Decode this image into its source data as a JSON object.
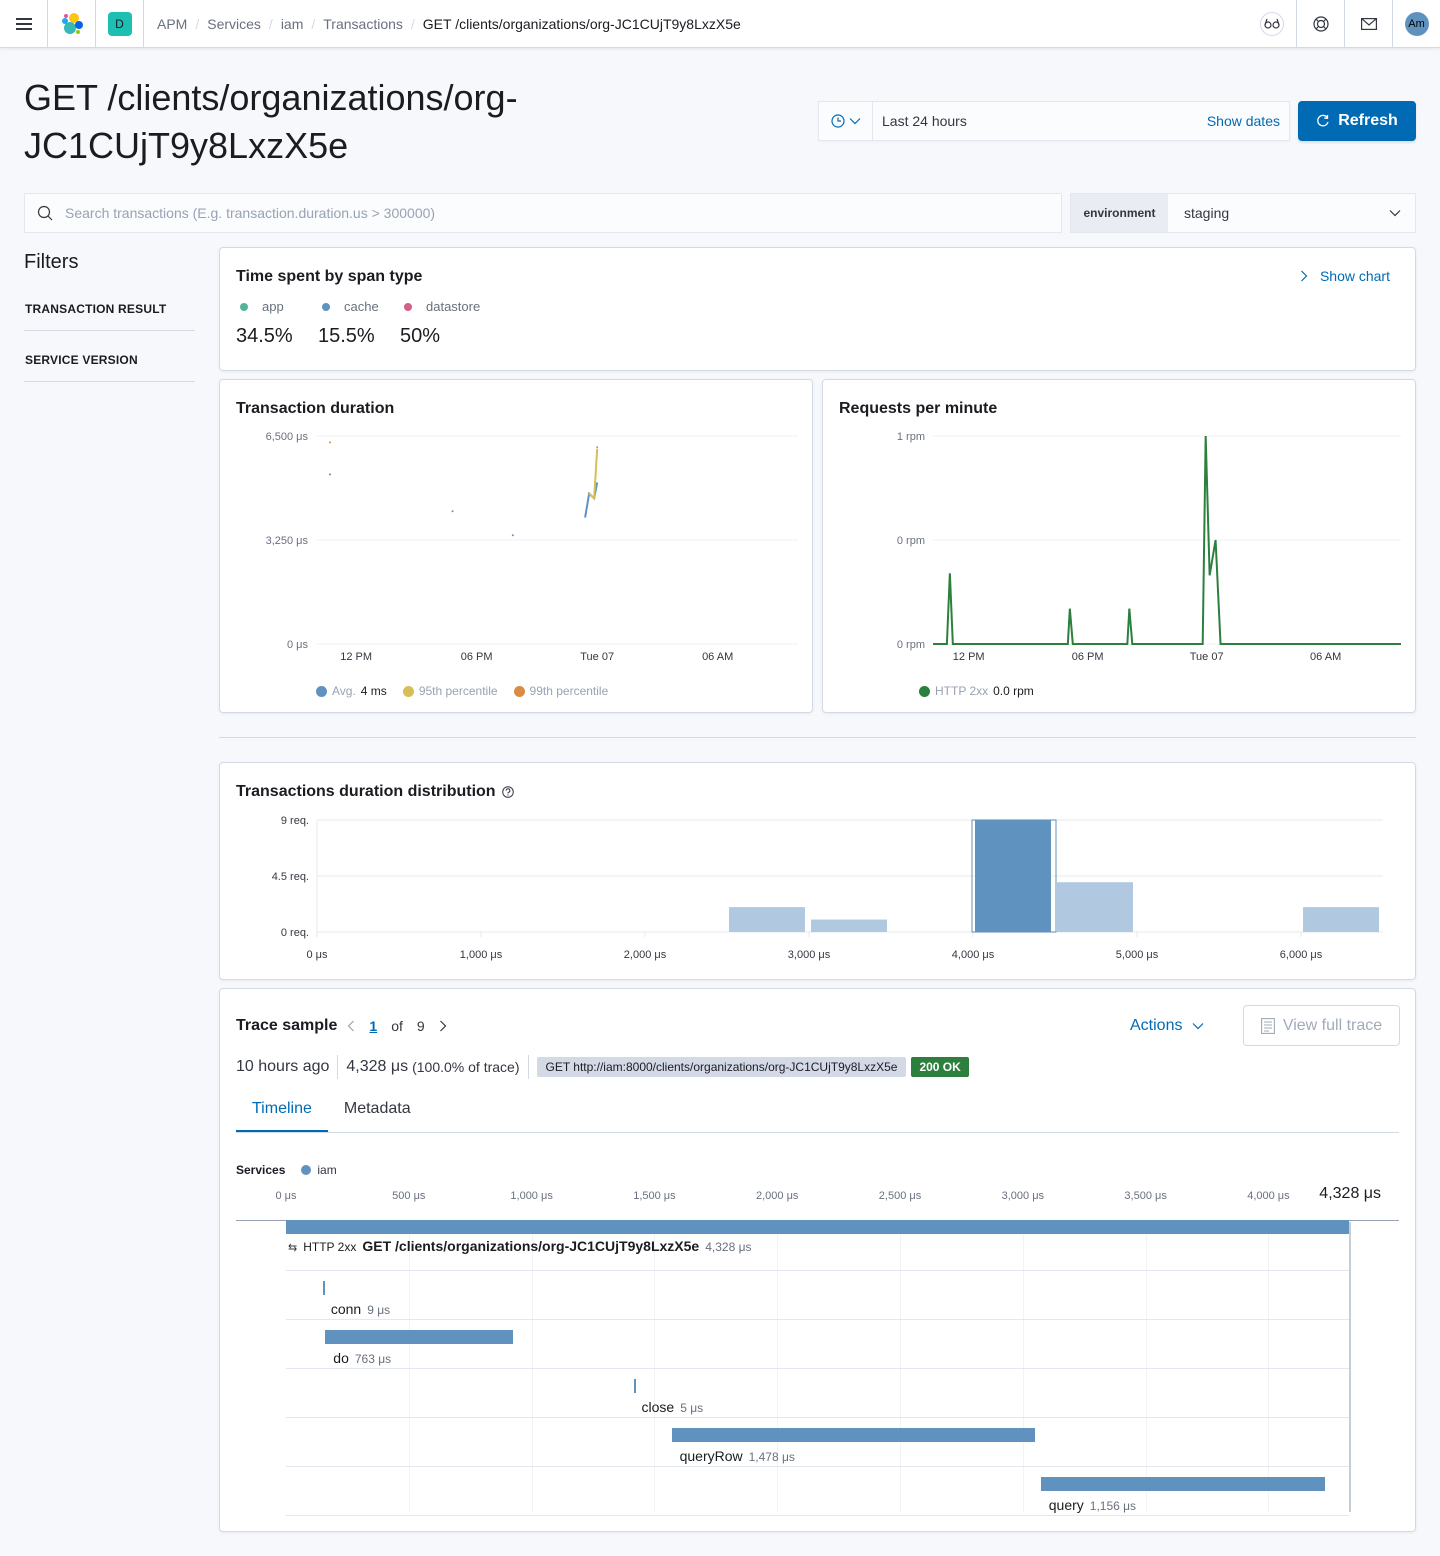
{
  "header": {
    "space_initial": "D",
    "breadcrumbs": [
      "APM",
      "Services",
      "iam",
      "Transactions",
      "GET /clients/organizations/org-JC1CUjT9y8LxzX5e"
    ],
    "avatar_initials": "Am"
  },
  "page": {
    "title": "GET /clients/organizations/org-JC1CUjT9y8LxzX5e"
  },
  "datepicker": {
    "value": "Last 24 hours",
    "show_dates_label": "Show dates",
    "refresh_label": "Refresh"
  },
  "search": {
    "placeholder": "Search transactions (E.g. transaction.duration.us > 300000)"
  },
  "environment": {
    "label": "environment",
    "value": "staging"
  },
  "filters": {
    "title": "Filters",
    "items": [
      "TRANSACTION RESULT",
      "SERVICE VERSION"
    ]
  },
  "span_types": {
    "title": "Time spent by span type",
    "show_chart_label": "Show chart",
    "items": [
      {
        "label": "app",
        "value": "34.5%",
        "color": "#54b399"
      },
      {
        "label": "cache",
        "value": "15.5%",
        "color": "#6092c0"
      },
      {
        "label": "datastore",
        "value": "50%",
        "color": "#d36086"
      }
    ]
  },
  "transaction_duration": {
    "title": "Transaction duration",
    "legend": [
      {
        "label": "Avg.",
        "value": "4 ms",
        "color": "#6092c0"
      },
      {
        "label": "95th percentile",
        "value": "",
        "color": "#d6bf57"
      },
      {
        "label": "99th percentile",
        "value": "",
        "color": "#da8b45"
      }
    ]
  },
  "requests_per_minute": {
    "title": "Requests per minute",
    "legend": [
      {
        "label": "HTTP 2xx",
        "value": "0.0 rpm",
        "color": "#2d7f3e"
      }
    ]
  },
  "distribution": {
    "title": "Transactions duration distribution"
  },
  "chart_data": [
    {
      "type": "line",
      "title": "Transaction duration",
      "x_ticks": [
        "12 PM",
        "06 PM",
        "Tue 07",
        "06 AM"
      ],
      "y_ticks": [
        "0 μs",
        "3,250 μs",
        "6,500 μs"
      ],
      "ylim": [
        0,
        6500
      ],
      "x_hours_range": [
        10,
        34
      ],
      "x_tick_hours": [
        12,
        18,
        24,
        30
      ],
      "series": [
        {
          "name": "Avg.",
          "color": "#6092c0",
          "points": [
            [
              10.7,
              5300
            ],
            [
              16.8,
              4150
            ],
            [
              19.8,
              3400
            ],
            [
              23.4,
              3950
            ],
            [
              23.6,
              4700
            ],
            [
              23.85,
              4550
            ],
            [
              24.0,
              5050
            ]
          ]
        },
        {
          "name": "95th percentile",
          "color": "#d6bf57",
          "points": [
            [
              23.6,
              4700
            ],
            [
              23.85,
              4550
            ],
            [
              24.0,
              6100
            ]
          ]
        },
        {
          "name": "99th percentile",
          "color": "#da8b45",
          "points": [
            [
              10.7,
              6300
            ],
            [
              24.0,
              6150
            ]
          ]
        }
      ]
    },
    {
      "type": "line",
      "title": "Requests per minute",
      "x_ticks": [
        "12 PM",
        "06 PM",
        "Tue 07",
        "06 AM"
      ],
      "y_ticks": [
        "0 rpm",
        "0 rpm",
        "1 rpm"
      ],
      "ylim": [
        0,
        1
      ],
      "x_hours_range": [
        10.2,
        33.8
      ],
      "x_tick_hours": [
        12,
        18,
        24,
        30
      ],
      "series": [
        {
          "name": "HTTP 2xx",
          "color": "#2d7f3e",
          "points": [
            [
              10.2,
              0
            ],
            [
              10.9,
              0
            ],
            [
              11.05,
              0.34
            ],
            [
              11.2,
              0
            ],
            [
              17.0,
              0
            ],
            [
              17.1,
              0.17
            ],
            [
              17.25,
              0
            ],
            [
              20.0,
              0
            ],
            [
              20.1,
              0.17
            ],
            [
              20.25,
              0
            ],
            [
              23.8,
              0
            ],
            [
              23.95,
              1.0
            ],
            [
              24.15,
              0.33
            ],
            [
              24.45,
              0.5
            ],
            [
              24.7,
              0
            ],
            [
              33.8,
              0
            ]
          ]
        }
      ]
    },
    {
      "type": "bar",
      "title": "Transactions duration distribution",
      "xlabel": "",
      "ylabel": "",
      "x_ticks": [
        "0 μs",
        "1,000 μs",
        "2,000 μs",
        "3,000 μs",
        "4,000 μs",
        "5,000 μs",
        "6,000 μs"
      ],
      "y_ticks": [
        "0 req.",
        "4.5 req.",
        "9 req."
      ],
      "xlim": [
        0,
        6500
      ],
      "ylim": [
        0,
        9
      ],
      "bins": [
        {
          "start": 2500,
          "end": 3000,
          "count": 2,
          "selected": false
        },
        {
          "start": 3000,
          "end": 3500,
          "count": 1,
          "selected": false
        },
        {
          "start": 4000,
          "end": 4500,
          "count": 9,
          "selected": true
        },
        {
          "start": 4500,
          "end": 5000,
          "count": 4,
          "selected": false
        },
        {
          "start": 6000,
          "end": 6500,
          "count": 2,
          "selected": false
        }
      ]
    }
  ],
  "trace": {
    "title": "Trace sample",
    "page_current": "1",
    "page_of": "of",
    "page_total": "9",
    "actions_label": "Actions",
    "view_full_trace_label": "View full trace",
    "age": "10 hours ago",
    "duration": "4,328 μs",
    "duration_pct": "(100.0% of trace)",
    "url": "GET http://iam:8000/clients/organizations/org-JC1CUjT9y8LxzX5e",
    "status": "200 OK",
    "tabs": [
      "Timeline",
      "Metadata"
    ],
    "services_label": "Services",
    "service_name": "iam",
    "total_label": "4,328 μs",
    "total_us": 4328,
    "axis_ticks": [
      "0 μs",
      "500 μs",
      "1,000 μs",
      "1,500 μs",
      "2,000 μs",
      "2,500 μs",
      "3,000 μs",
      "3,500 μs",
      "4,000 μs"
    ],
    "axis_tick_values": [
      0,
      500,
      1000,
      1500,
      2000,
      2500,
      3000,
      3500,
      4000
    ],
    "root": {
      "result": "HTTP 2xx",
      "name": "GET /clients/organizations/org-JC1CUjT9y8LxzX5e",
      "duration": "4,328 μs",
      "start_us": 0,
      "dur_us": 4328
    },
    "spans": [
      {
        "name": "conn",
        "duration": "9 μs",
        "start_us": 150,
        "dur_us": 9
      },
      {
        "name": "do",
        "duration": "763 μs",
        "start_us": 160,
        "dur_us": 763
      },
      {
        "name": "close",
        "duration": "5 μs",
        "start_us": 1415,
        "dur_us": 5
      },
      {
        "name": "queryRow",
        "duration": "1,478 μs",
        "start_us": 1570,
        "dur_us": 1478
      },
      {
        "name": "query",
        "duration": "1,156 μs",
        "start_us": 3073,
        "dur_us": 1156
      }
    ]
  }
}
